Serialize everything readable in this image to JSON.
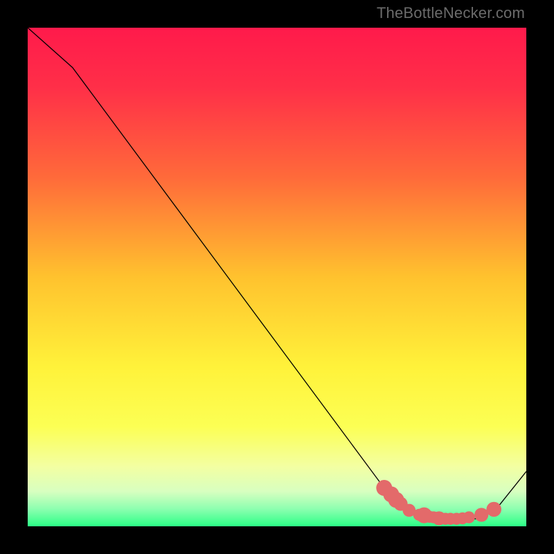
{
  "attribution": "TheBottleNecker.com",
  "chart_data": {
    "type": "line",
    "title": "",
    "xlabel": "",
    "ylabel": "",
    "xlim": [
      0,
      100
    ],
    "ylim": [
      0,
      100
    ],
    "gradient_stops": [
      {
        "offset": 0.0,
        "color": "#ff1a4b"
      },
      {
        "offset": 0.12,
        "color": "#ff2f48"
      },
      {
        "offset": 0.3,
        "color": "#ff6a3a"
      },
      {
        "offset": 0.5,
        "color": "#ffc22e"
      },
      {
        "offset": 0.68,
        "color": "#fff23a"
      },
      {
        "offset": 0.8,
        "color": "#fcff54"
      },
      {
        "offset": 0.88,
        "color": "#f3ffa2"
      },
      {
        "offset": 0.93,
        "color": "#d8ffc0"
      },
      {
        "offset": 0.965,
        "color": "#8dffb0"
      },
      {
        "offset": 1.0,
        "color": "#2bff86"
      }
    ],
    "curve_points": [
      {
        "x": 0,
        "y": 100
      },
      {
        "x": 9,
        "y": 92
      },
      {
        "x": 72,
        "y": 7
      },
      {
        "x": 77,
        "y": 3
      },
      {
        "x": 82,
        "y": 1.5
      },
      {
        "x": 90,
        "y": 1.5
      },
      {
        "x": 94,
        "y": 3.5
      },
      {
        "x": 100,
        "y": 11
      }
    ],
    "markers": [
      {
        "x": 71.5,
        "y": 7.7,
        "r": 1.6
      },
      {
        "x": 72.9,
        "y": 6.4,
        "r": 1.6
      },
      {
        "x": 73.9,
        "y": 5.3,
        "r": 1.6
      },
      {
        "x": 74.8,
        "y": 4.5,
        "r": 1.4
      },
      {
        "x": 76.5,
        "y": 3.2,
        "r": 1.3
      },
      {
        "x": 78.5,
        "y": 2.3,
        "r": 1.2
      },
      {
        "x": 79.5,
        "y": 2.2,
        "r": 1.6
      },
      {
        "x": 80.6,
        "y": 1.9,
        "r": 1.2
      },
      {
        "x": 81.4,
        "y": 1.8,
        "r": 1.2
      },
      {
        "x": 82.5,
        "y": 1.6,
        "r": 1.4
      },
      {
        "x": 83.8,
        "y": 1.5,
        "r": 1.2
      },
      {
        "x": 84.8,
        "y": 1.5,
        "r": 1.2
      },
      {
        "x": 86.0,
        "y": 1.5,
        "r": 1.2
      },
      {
        "x": 87.2,
        "y": 1.6,
        "r": 1.2
      },
      {
        "x": 88.5,
        "y": 1.8,
        "r": 1.2
      },
      {
        "x": 91.0,
        "y": 2.3,
        "r": 1.4
      },
      {
        "x": 93.5,
        "y": 3.4,
        "r": 1.5
      }
    ],
    "marker_color": "#e36a6a",
    "curve_color": "#000000"
  }
}
